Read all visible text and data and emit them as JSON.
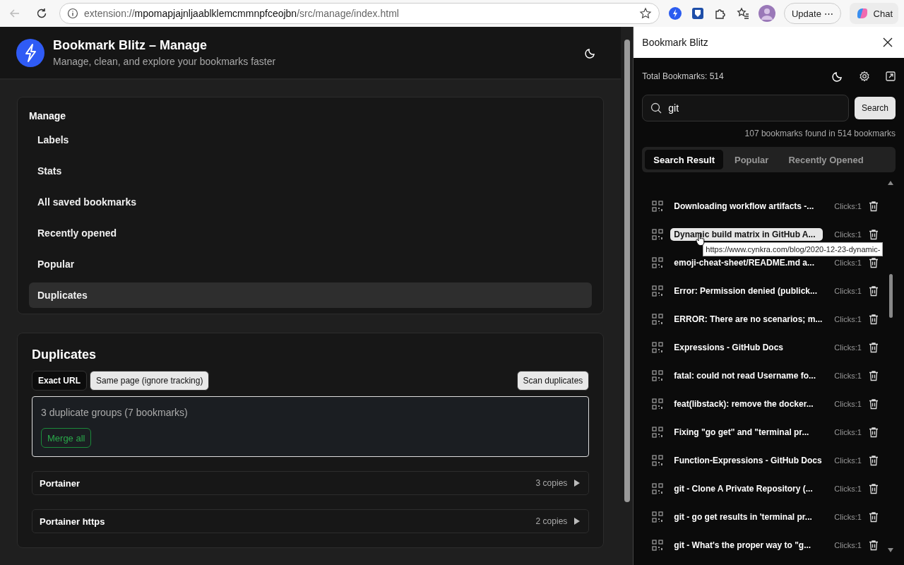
{
  "browser": {
    "url": {
      "scheme": "extension://",
      "host": "mpomapjajnljaablklemcmmnpfceojbn",
      "path": "/src/manage/index.html"
    },
    "update_button": "Update",
    "more": "⋯",
    "chat_button": "Chat"
  },
  "header": {
    "title": "Bookmark Blitz – Manage",
    "subtitle": "Manage, clean, and explore your bookmarks faster"
  },
  "nav": {
    "heading": "Manage",
    "items": [
      {
        "label": "Labels",
        "selected": false
      },
      {
        "label": "Stats",
        "selected": false
      },
      {
        "label": "All saved bookmarks",
        "selected": false
      },
      {
        "label": "Recently opened",
        "selected": false
      },
      {
        "label": "Popular",
        "selected": false
      },
      {
        "label": "Duplicates",
        "selected": true
      }
    ]
  },
  "duplicates": {
    "title": "Duplicates",
    "modes": [
      {
        "label": "Exact URL",
        "selected": true
      },
      {
        "label": "Same page (ignore tracking)",
        "selected": false
      }
    ],
    "scan_button": "Scan duplicates",
    "summary": "3 duplicate groups (7 bookmarks)",
    "merge_button": "Merge all",
    "groups": [
      {
        "name": "Portainer",
        "copies": "3 copies",
        "expanded": false
      },
      {
        "name": "Portainer https",
        "copies": "2 copies",
        "expanded": false
      }
    ]
  },
  "panel": {
    "title": "Bookmark Blitz",
    "total": "Total Bookmarks: 514",
    "search": {
      "value": "git"
    },
    "search_button": "Search",
    "found": "107 bookmarks found in 514 bookmarks",
    "tabs": [
      {
        "label": "Search Result",
        "selected": true
      },
      {
        "label": "Popular",
        "selected": false
      },
      {
        "label": "Recently Opened",
        "selected": false
      }
    ],
    "results": [
      {
        "title": "Downloading workflow artifacts -...",
        "clicks": "Clicks:1",
        "hovered": false
      },
      {
        "title": "Dynamic build matrix in GitHub A...",
        "clicks": "Clicks:1",
        "hovered": true
      },
      {
        "title": "emoji-cheat-sheet/README.md a...",
        "clicks": "Clicks:1",
        "hovered": false
      },
      {
        "title": "Error: Permission denied (publick...",
        "clicks": "Clicks:1",
        "hovered": false
      },
      {
        "title": "ERROR: There are no scenarios; m...",
        "clicks": "Clicks:1",
        "hovered": false
      },
      {
        "title": "Expressions - GitHub Docs",
        "clicks": "Clicks:1",
        "hovered": false
      },
      {
        "title": "fatal: could not read Username fo...",
        "clicks": "Clicks:1",
        "hovered": false
      },
      {
        "title": "feat(libstack): remove the docker...",
        "clicks": "Clicks:1",
        "hovered": false
      },
      {
        "title": "Fixing \"go get\" and \"terminal pr...",
        "clicks": "Clicks:1",
        "hovered": false
      },
      {
        "title": "Function-Expressions - GitHub Docs",
        "clicks": "Clicks:1",
        "hovered": false
      },
      {
        "title": "git - Clone A Private Repository (...",
        "clicks": "Clicks:1",
        "hovered": false
      },
      {
        "title": "git - go get results in 'terminal pr...",
        "clicks": "Clicks:1",
        "hovered": false
      },
      {
        "title": "git - What's the proper way to \"g...",
        "clicks": "Clicks:1",
        "hovered": false
      }
    ],
    "tooltip": "https://www.cynkra.com/blog/2020-12-23-dynamic-"
  }
}
